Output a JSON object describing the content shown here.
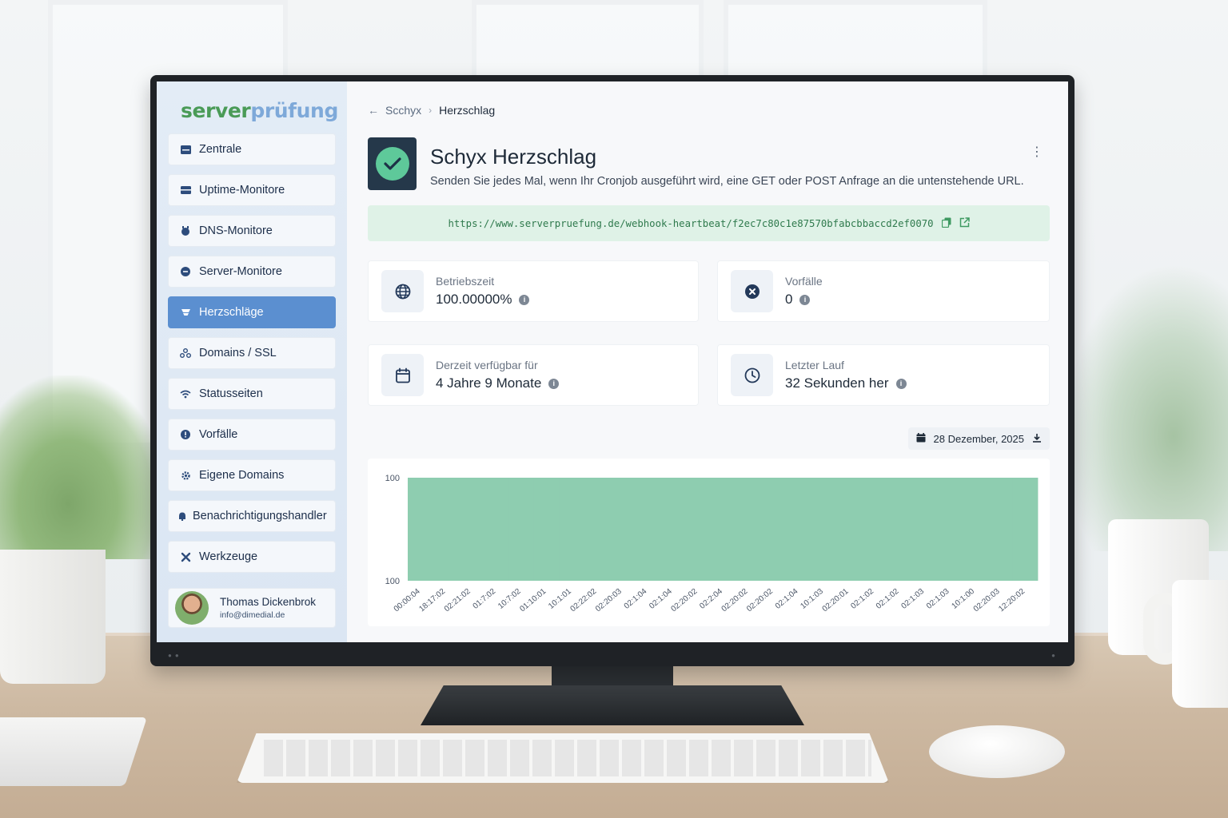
{
  "brand": {
    "part1": "server",
    "part2": "prüfung"
  },
  "sidebar": {
    "items": [
      {
        "label": "Zentrale",
        "icon": "dashboard-icon",
        "active": false
      },
      {
        "label": "Uptime-Monitore",
        "icon": "uptime-icon",
        "active": false
      },
      {
        "label": "DNS-Monitore",
        "icon": "dns-icon",
        "active": false
      },
      {
        "label": "Server-Monitore",
        "icon": "server-icon",
        "active": false
      },
      {
        "label": "Herzschläge",
        "icon": "heartbeat-icon",
        "active": true
      },
      {
        "label": "Domains / SSL",
        "icon": "domains-icon",
        "active": false
      },
      {
        "label": "Statusseiten",
        "icon": "wifi-icon",
        "active": false
      },
      {
        "label": "Vorfälle",
        "icon": "incident-icon",
        "active": false
      },
      {
        "label": "Eigene Domains",
        "icon": "custom-domain-icon",
        "active": false
      },
      {
        "label": "Benachrichtigungshandler",
        "icon": "notification-icon",
        "active": false
      },
      {
        "label": "Werkzeuge",
        "icon": "tools-icon",
        "active": false
      }
    ],
    "user": {
      "name": "Thomas Dickenbrok",
      "email": "info@dimedial.de"
    }
  },
  "breadcrumb": {
    "parent": "Scchyx",
    "current": "Herzschlag"
  },
  "header": {
    "title": "Schyx Herzschlag",
    "description": "Senden Sie jedes Mal, wenn Ihr Cronjob ausgeführt wird, eine GET oder POST Anfrage an die untenstehende URL."
  },
  "webhook": {
    "url": "https://www.serverpruefung.de/webhook-heartbeat/f2ec7c80c1e87570bfabcbbaccd2ef0070"
  },
  "stats": {
    "uptime": {
      "label": "Betriebszeit",
      "value": "100.00000%"
    },
    "incidents": {
      "label": "Vorfälle",
      "value": "0"
    },
    "available": {
      "label": "Derzeit verfügbar für",
      "value": "4 Jahre 9 Monate"
    },
    "last_run": {
      "label": "Letzter Lauf",
      "value": "32 Sekunden her"
    }
  },
  "date_filter": {
    "label": "28 Dezember, 2025"
  },
  "colors": {
    "accent": "#5b8fd0",
    "success": "#5ec99a",
    "bar": "#8ecdb0"
  },
  "chart_data": {
    "type": "bar",
    "categories": [
      "00:00:04",
      "18:17:02",
      "02:21:02",
      "01:7:02",
      "10:7:02",
      "01:10:01",
      "10:1:01",
      "02:22:02",
      "02:20:03",
      "02:1:04",
      "02:1:04",
      "02:20:02",
      "02:2:04",
      "02:20:02",
      "02:20:02",
      "02:1:04",
      "10:1:03",
      "02:20:01",
      "02:1:02",
      "02:1:02",
      "02:1:03",
      "02:1:03",
      "10:1:00",
      "02:20:03",
      "12:20:02"
    ],
    "values": [
      100,
      100,
      100,
      100,
      100,
      100,
      100,
      100,
      100,
      100,
      100,
      100,
      100,
      100,
      100,
      100,
      100,
      100,
      100,
      100,
      100,
      100,
      100,
      100,
      100
    ],
    "y_tick_labels": [
      "100",
      "100"
    ],
    "title": "",
    "xlabel": "",
    "ylabel": "",
    "grid": false
  }
}
